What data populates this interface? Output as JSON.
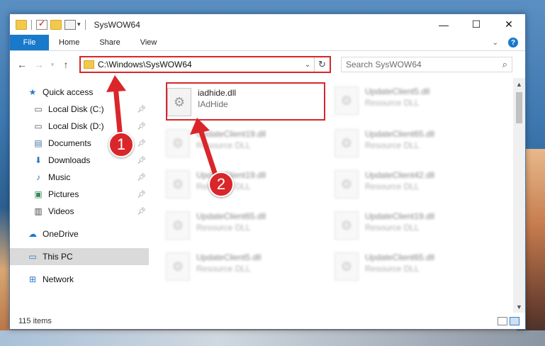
{
  "window": {
    "title": "SysWOW64",
    "controls": {
      "minimize": "—",
      "maximize": "☐",
      "close": "✕"
    }
  },
  "ribbon": {
    "tabs": [
      "File",
      "Home",
      "Share",
      "View"
    ],
    "collapse_glyph": "⌄",
    "help_glyph": "?"
  },
  "address": {
    "path": "C:\\Windows\\SysWOW64",
    "search_placeholder": "Search SysWOW64"
  },
  "nav": {
    "quick_access": "Quick access",
    "items": [
      {
        "label": "Local Disk (C:)",
        "icon": "drive-icon"
      },
      {
        "label": "Local Disk (D:)",
        "icon": "drive-icon"
      },
      {
        "label": "Documents",
        "icon": "documents-icon"
      },
      {
        "label": "Downloads",
        "icon": "downloads-icon"
      },
      {
        "label": "Music",
        "icon": "music-icon"
      },
      {
        "label": "Pictures",
        "icon": "pictures-icon"
      },
      {
        "label": "Videos",
        "icon": "videos-icon"
      }
    ],
    "onedrive": "OneDrive",
    "this_pc": "This PC",
    "network": "Network"
  },
  "files": [
    {
      "name": "iadhide.dll",
      "desc": "IAdHide"
    },
    {
      "name": "UpdateClient5.dll",
      "desc": "Resource DLL"
    },
    {
      "name": "UpdateClient19.dll",
      "desc": "Resource DLL"
    },
    {
      "name": "UpdateClient65.dll",
      "desc": "Resource DLL"
    },
    {
      "name": "UpdateClient19.dll",
      "desc": "Resource DLL"
    },
    {
      "name": "UpdateClient42.dll",
      "desc": "Resource DLL"
    },
    {
      "name": "UpdateClient65.dll",
      "desc": "Resource DLL"
    },
    {
      "name": "UpdateClient19.dll",
      "desc": "Resource DLL"
    },
    {
      "name": "UpdateClient5.dll",
      "desc": "Resource DLL"
    },
    {
      "name": "UpdateClient65.dll",
      "desc": "Resource DLL"
    }
  ],
  "status": {
    "items": "115 items"
  },
  "annotations": {
    "step1": "1",
    "step2": "2"
  },
  "colors": {
    "accent": "#1979ca",
    "highlight": "#d9262a"
  }
}
